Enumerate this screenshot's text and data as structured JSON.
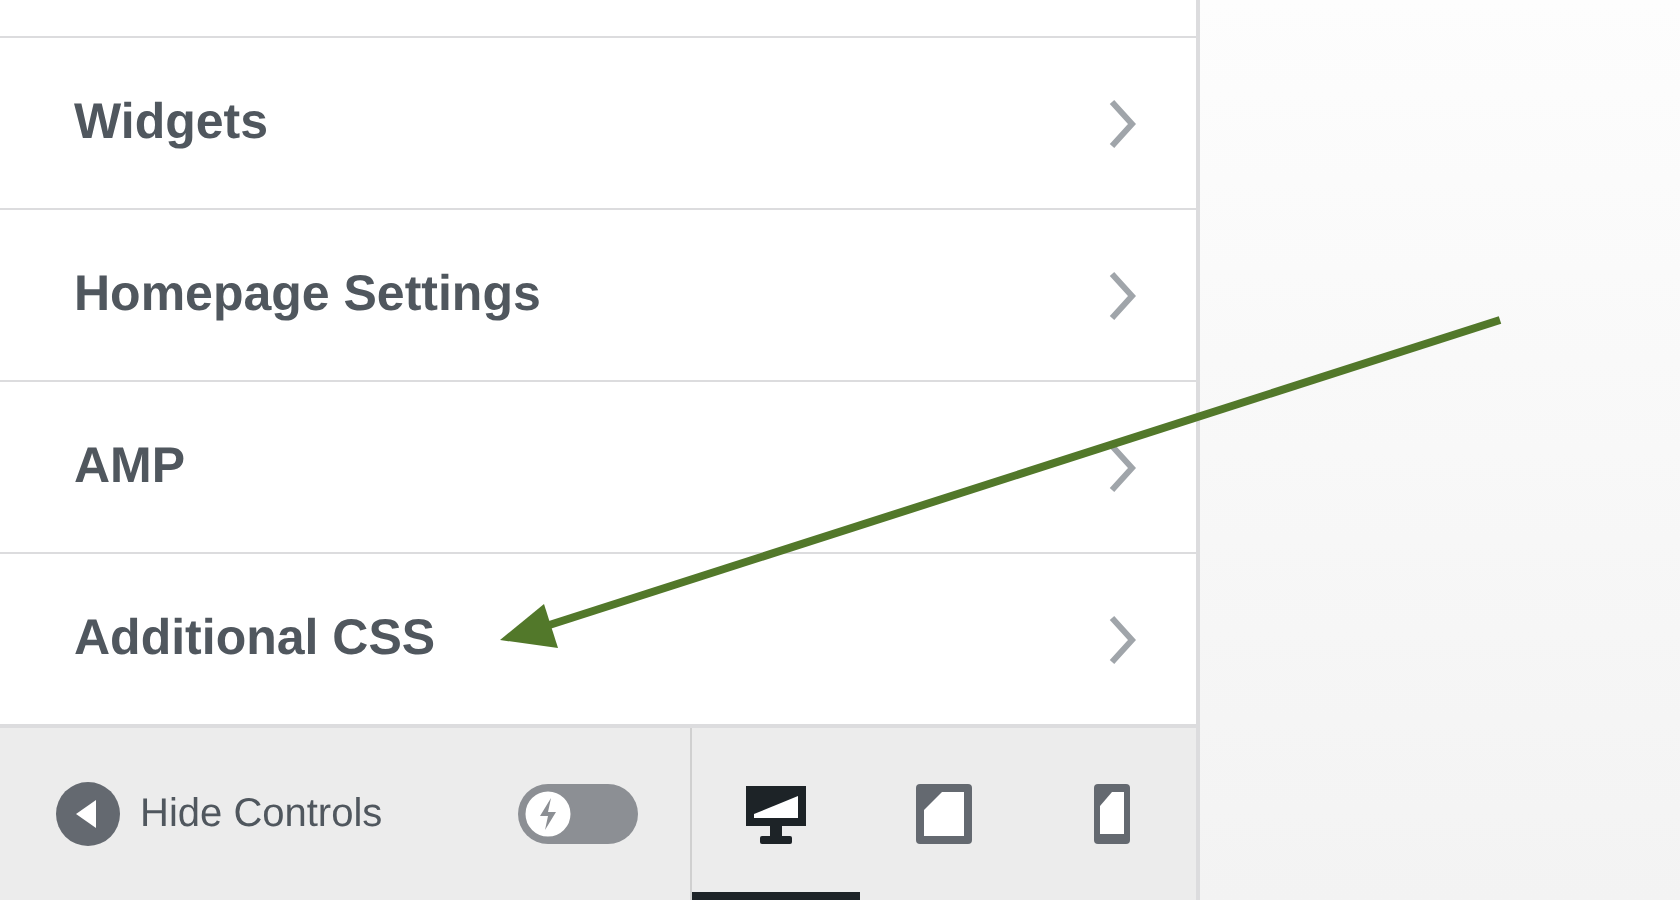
{
  "sections": [
    {
      "label": "Widgets"
    },
    {
      "label": "Homepage Settings"
    },
    {
      "label": "AMP"
    },
    {
      "label": "Additional CSS"
    }
  ],
  "footer": {
    "hide_controls": {
      "label": "Hide Controls"
    },
    "toggle": {
      "on": false
    },
    "devices": [
      {
        "kind": "desktop",
        "selected": true
      },
      {
        "kind": "tablet",
        "selected": false
      },
      {
        "kind": "mobile",
        "selected": false
      }
    ]
  },
  "annotation": {
    "kind": "arrow"
  }
}
